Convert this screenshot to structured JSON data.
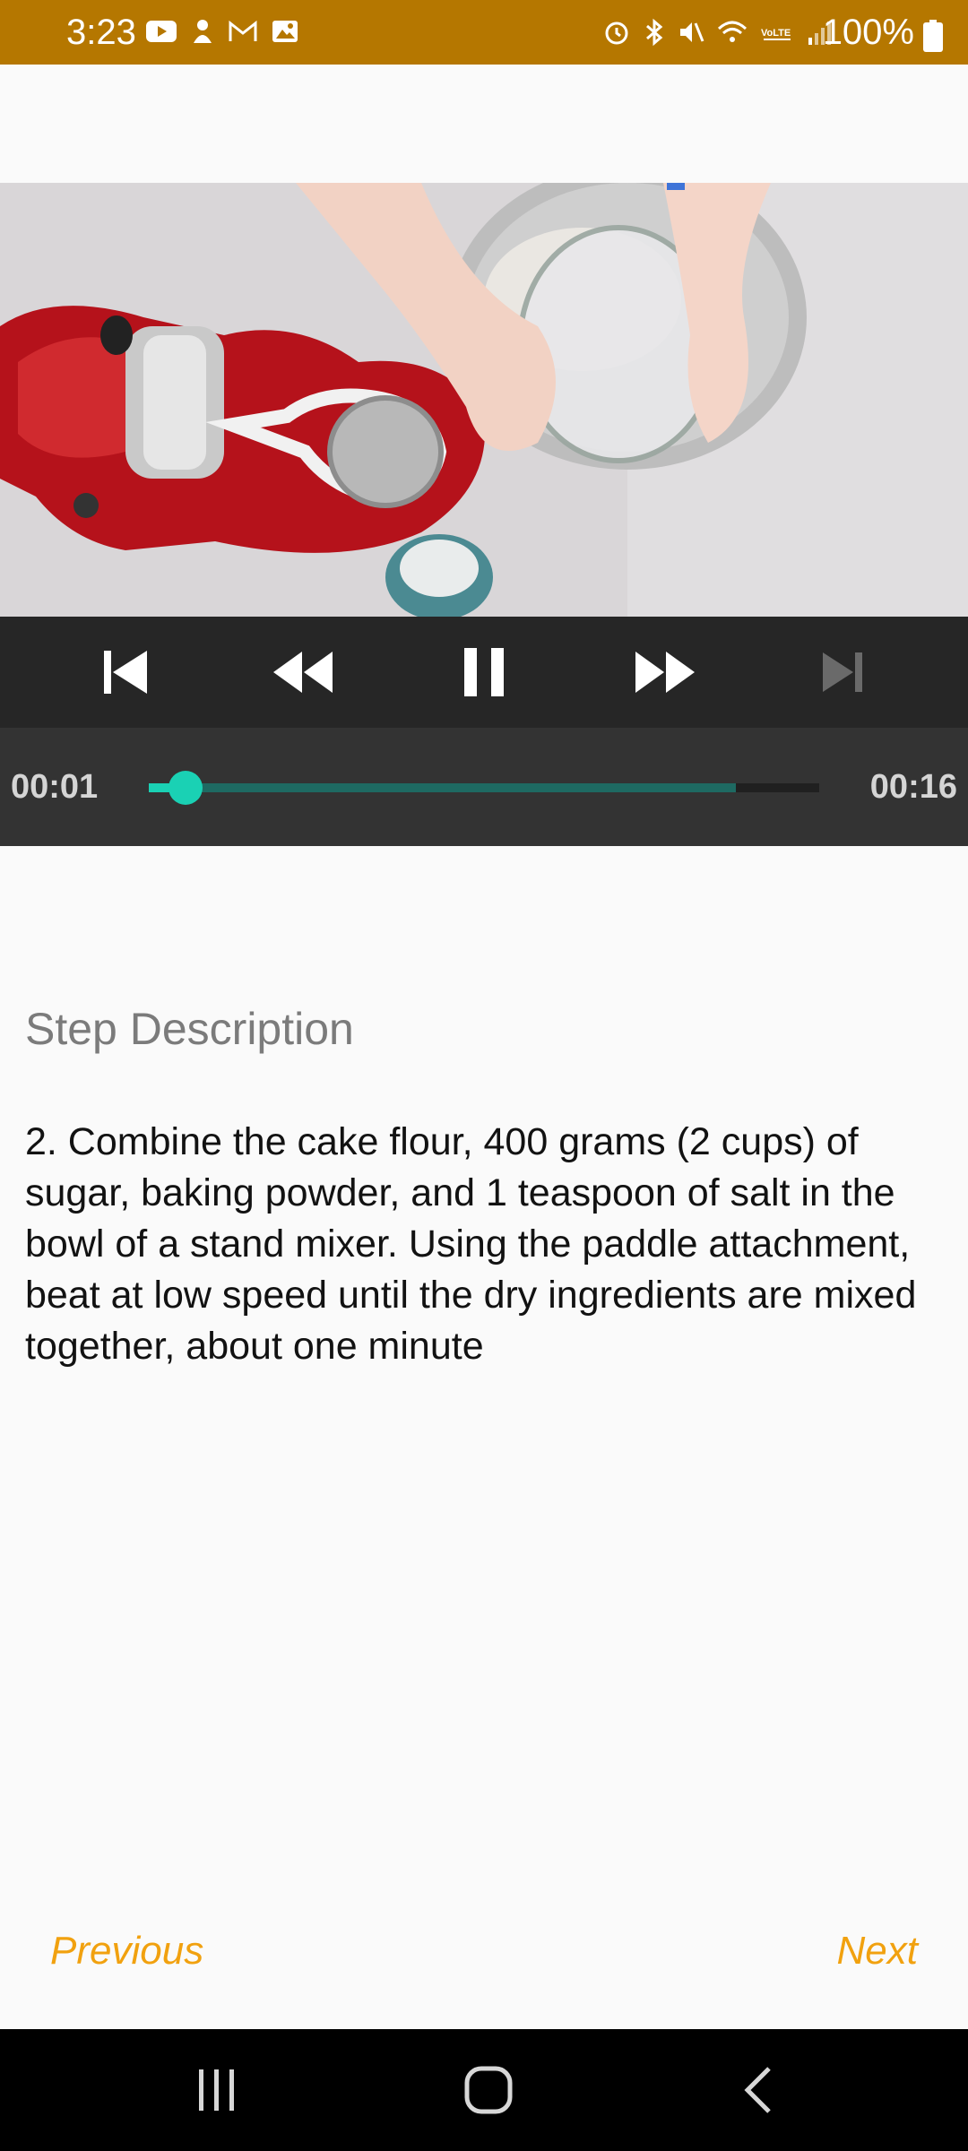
{
  "status_bar": {
    "time": "3:23",
    "battery": "100%",
    "background": "#b57700"
  },
  "player": {
    "current_time": "00:01",
    "total_time": "00:16",
    "played_fraction": 0.055,
    "buffered_fraction": 0.875,
    "accent_color": "#1ad1b4",
    "controls": [
      "skip-previous-icon",
      "rewind-icon",
      "pause-icon",
      "fast-forward-icon",
      "skip-next-icon"
    ]
  },
  "step": {
    "heading": "Step Description",
    "text": "2. Combine the cake flour, 400 grams (2 cups) of sugar, baking powder, and 1 teaspoon of salt in the bowl of a stand mixer. Using the paddle attachment, beat at low speed until the dry ingredients are mixed together, about one minute"
  },
  "navigation": {
    "previous_label": "Previous",
    "next_label": "Next",
    "link_color": "#f1a10f"
  }
}
